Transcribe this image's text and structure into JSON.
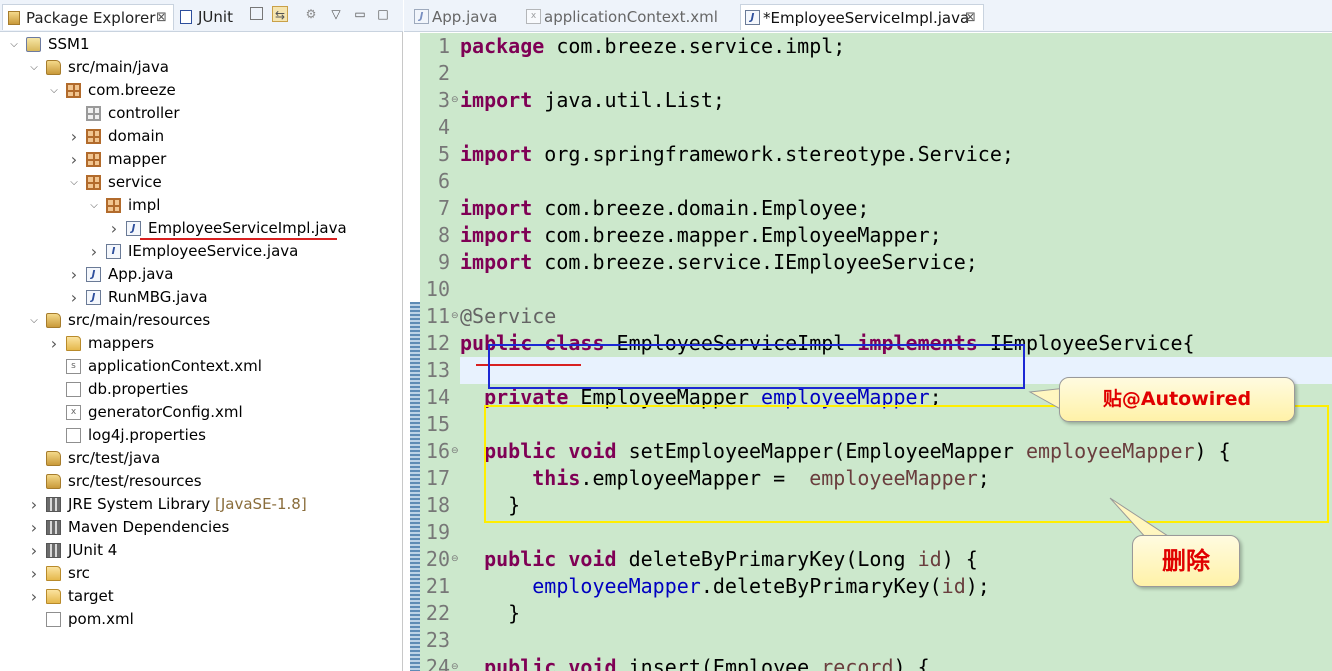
{
  "left_panel": {
    "tabs": [
      {
        "label": "Package Explorer",
        "close": "⊠"
      },
      {
        "label": "JUnit"
      }
    ],
    "toolbar_icons": [
      "collapse-all-icon",
      "link-with-editor-icon",
      "focus-icon",
      "view-menu-icon",
      "minimize-icon",
      "maximize-icon"
    ],
    "tree": [
      {
        "label": "SSM1",
        "icon": "project-icon",
        "arrow": "down"
      },
      {
        "label": "src/main/java",
        "icon": "source-folder-icon",
        "arrow": "down"
      },
      {
        "label": "com.breeze",
        "icon": "package-icon",
        "arrow": "down"
      },
      {
        "label": "controller",
        "icon": "empty-package-icon",
        "arrow": ""
      },
      {
        "label": "domain",
        "icon": "package-icon",
        "arrow": "right"
      },
      {
        "label": "mapper",
        "icon": "package-icon",
        "arrow": "right"
      },
      {
        "label": "service",
        "icon": "package-icon",
        "arrow": "down"
      },
      {
        "label": "impl",
        "icon": "package-icon",
        "arrow": "down"
      },
      {
        "label": "EmployeeServiceImpl.java",
        "icon": "java-file-icon",
        "arrow": "right"
      },
      {
        "label": "IEmployeeService.java",
        "icon": "java-interface-file-icon",
        "arrow": "right"
      },
      {
        "label": "App.java",
        "icon": "java-file-icon",
        "arrow": "right"
      },
      {
        "label": "RunMBG.java",
        "icon": "java-file-icon",
        "arrow": "right"
      },
      {
        "label": "src/main/resources",
        "icon": "source-folder-icon",
        "arrow": "down"
      },
      {
        "label": "mappers",
        "icon": "folder-icon",
        "arrow": "right"
      },
      {
        "label": "applicationContext.xml",
        "icon": "spring-xml-icon",
        "arrow": ""
      },
      {
        "label": "db.properties",
        "icon": "properties-file-icon",
        "arrow": ""
      },
      {
        "label": "generatorConfig.xml",
        "icon": "xml-file-icon",
        "arrow": ""
      },
      {
        "label": "log4j.properties",
        "icon": "properties-file-icon",
        "arrow": ""
      },
      {
        "label": "src/test/java",
        "icon": "source-folder-icon",
        "arrow": ""
      },
      {
        "label": "src/test/resources",
        "icon": "source-folder-icon",
        "arrow": ""
      },
      {
        "label": "JRE System Library",
        "decoration": "[JavaSE-1.8]",
        "icon": "library-icon",
        "arrow": "right"
      },
      {
        "label": "Maven Dependencies",
        "icon": "library-icon",
        "arrow": "right"
      },
      {
        "label": "JUnit 4",
        "icon": "library-icon",
        "arrow": "right"
      },
      {
        "label": "src",
        "icon": "folder-icon",
        "arrow": "right"
      },
      {
        "label": "target",
        "icon": "folder-icon",
        "arrow": "right"
      },
      {
        "label": "pom.xml",
        "icon": "maven-pom-icon",
        "arrow": ""
      }
    ]
  },
  "editor": {
    "tabs": [
      {
        "label": "App.java",
        "active": false
      },
      {
        "label": "applicationContext.xml",
        "active": false
      },
      {
        "label": "*EmployeeServiceImpl.java",
        "active": true,
        "close": "⊠"
      }
    ],
    "lines": [
      {
        "n": "1",
        "fold": "",
        "tokens": [
          [
            "kw",
            "package"
          ],
          [
            "",
            "com.breeze.service.impl;"
          ]
        ]
      },
      {
        "n": "2",
        "fold": "",
        "tokens": []
      },
      {
        "n": "3",
        "fold": "⊖",
        "tokens": [
          [
            "kw",
            "import"
          ],
          [
            "",
            "java.util.List;"
          ]
        ]
      },
      {
        "n": "4",
        "fold": "",
        "tokens": []
      },
      {
        "n": "5",
        "fold": "",
        "tokens": [
          [
            "kw",
            "import"
          ],
          [
            "",
            "org.springframework.stereotype.Service;"
          ]
        ]
      },
      {
        "n": "6",
        "fold": "",
        "tokens": []
      },
      {
        "n": "7",
        "fold": "",
        "tokens": [
          [
            "kw",
            "import"
          ],
          [
            "",
            "com.breeze.domain.Employee;"
          ]
        ]
      },
      {
        "n": "8",
        "fold": "",
        "tokens": [
          [
            "kw",
            "import"
          ],
          [
            "",
            "com.breeze.mapper.EmployeeMapper;"
          ]
        ]
      },
      {
        "n": "9",
        "fold": "",
        "tokens": [
          [
            "kw",
            "import"
          ],
          [
            "",
            "com.breeze.service.IEmployeeService;"
          ]
        ]
      },
      {
        "n": "10",
        "fold": "",
        "tokens": []
      },
      {
        "n": "11",
        "fold": "⊖",
        "tokens": [
          [
            "ann",
            "@Service"
          ]
        ]
      },
      {
        "n": "12",
        "fold": "",
        "tokens": [
          [
            "kw",
            "public"
          ],
          [
            "kw",
            "class"
          ],
          [
            "",
            "EmployeeServiceImpl"
          ],
          [
            "kw",
            "implements"
          ],
          [
            "",
            "IEmployeeService{"
          ]
        ]
      },
      {
        "n": "13",
        "fold": "",
        "tokens": []
      },
      {
        "n": "14",
        "fold": "",
        "tokens": [
          [
            "",
            "  "
          ],
          [
            "kw",
            "private"
          ],
          [
            "",
            "EmployeeMapper"
          ],
          [
            "fld",
            "employeeMapper"
          ],
          [
            "",
            ";"
          ]
        ]
      },
      {
        "n": "15",
        "fold": "",
        "tokens": []
      },
      {
        "n": "16",
        "fold": "⊖",
        "tokens": [
          [
            "",
            "  "
          ],
          [
            "kw",
            "public"
          ],
          [
            "kw",
            "void"
          ],
          [
            "",
            "setEmployeeMapper(EmployeeMapper"
          ],
          [
            "prm",
            "employeeMapper"
          ],
          [
            "",
            ") {"
          ]
        ]
      },
      {
        "n": "17",
        "fold": "",
        "tokens": [
          [
            "",
            "      "
          ],
          [
            "kw",
            "this"
          ],
          [
            "",
            ".employeeMapper = "
          ],
          [
            "prm",
            "employeeMapper"
          ],
          [
            "",
            ";"
          ]
        ]
      },
      {
        "n": "18",
        "fold": "",
        "tokens": [
          [
            "",
            "    }"
          ]
        ]
      },
      {
        "n": "19",
        "fold": "",
        "tokens": []
      },
      {
        "n": "20",
        "fold": "⊖",
        "tokens": [
          [
            "",
            "  "
          ],
          [
            "kw",
            "public"
          ],
          [
            "kw",
            "void"
          ],
          [
            "",
            "deleteByPrimaryKey(Long"
          ],
          [
            "prm",
            "id"
          ],
          [
            "",
            ") {"
          ]
        ]
      },
      {
        "n": "21",
        "fold": "",
        "tokens": [
          [
            "",
            "      "
          ],
          [
            "fld",
            "employeeMapper"
          ],
          [
            "",
            ".deleteByPrimaryKey("
          ],
          [
            "prm",
            "id"
          ],
          [
            "",
            ");"
          ]
        ]
      },
      {
        "n": "22",
        "fold": "",
        "tokens": [
          [
            "",
            "    }"
          ]
        ]
      },
      {
        "n": "23",
        "fold": "",
        "tokens": []
      },
      {
        "n": "24",
        "fold": "⊖",
        "tokens": [
          [
            "",
            "  "
          ],
          [
            "kw",
            "public"
          ],
          [
            "kw",
            "void"
          ],
          [
            "",
            "insert(Employee"
          ],
          [
            "prm",
            "record"
          ],
          [
            "",
            ") {"
          ]
        ]
      }
    ]
  },
  "annotations": {
    "callout_autowired": "贴@Autowired",
    "callout_delete": "删除"
  },
  "colors": {
    "editor_bg": "#cce8cc",
    "keyword": "#7f0055",
    "field": "#0000c0",
    "annotation_box_blue": "#1c28d4",
    "annotation_box_yellow": "#ffee00",
    "underline_red": "#d82020",
    "callout_text": "#e00000"
  }
}
